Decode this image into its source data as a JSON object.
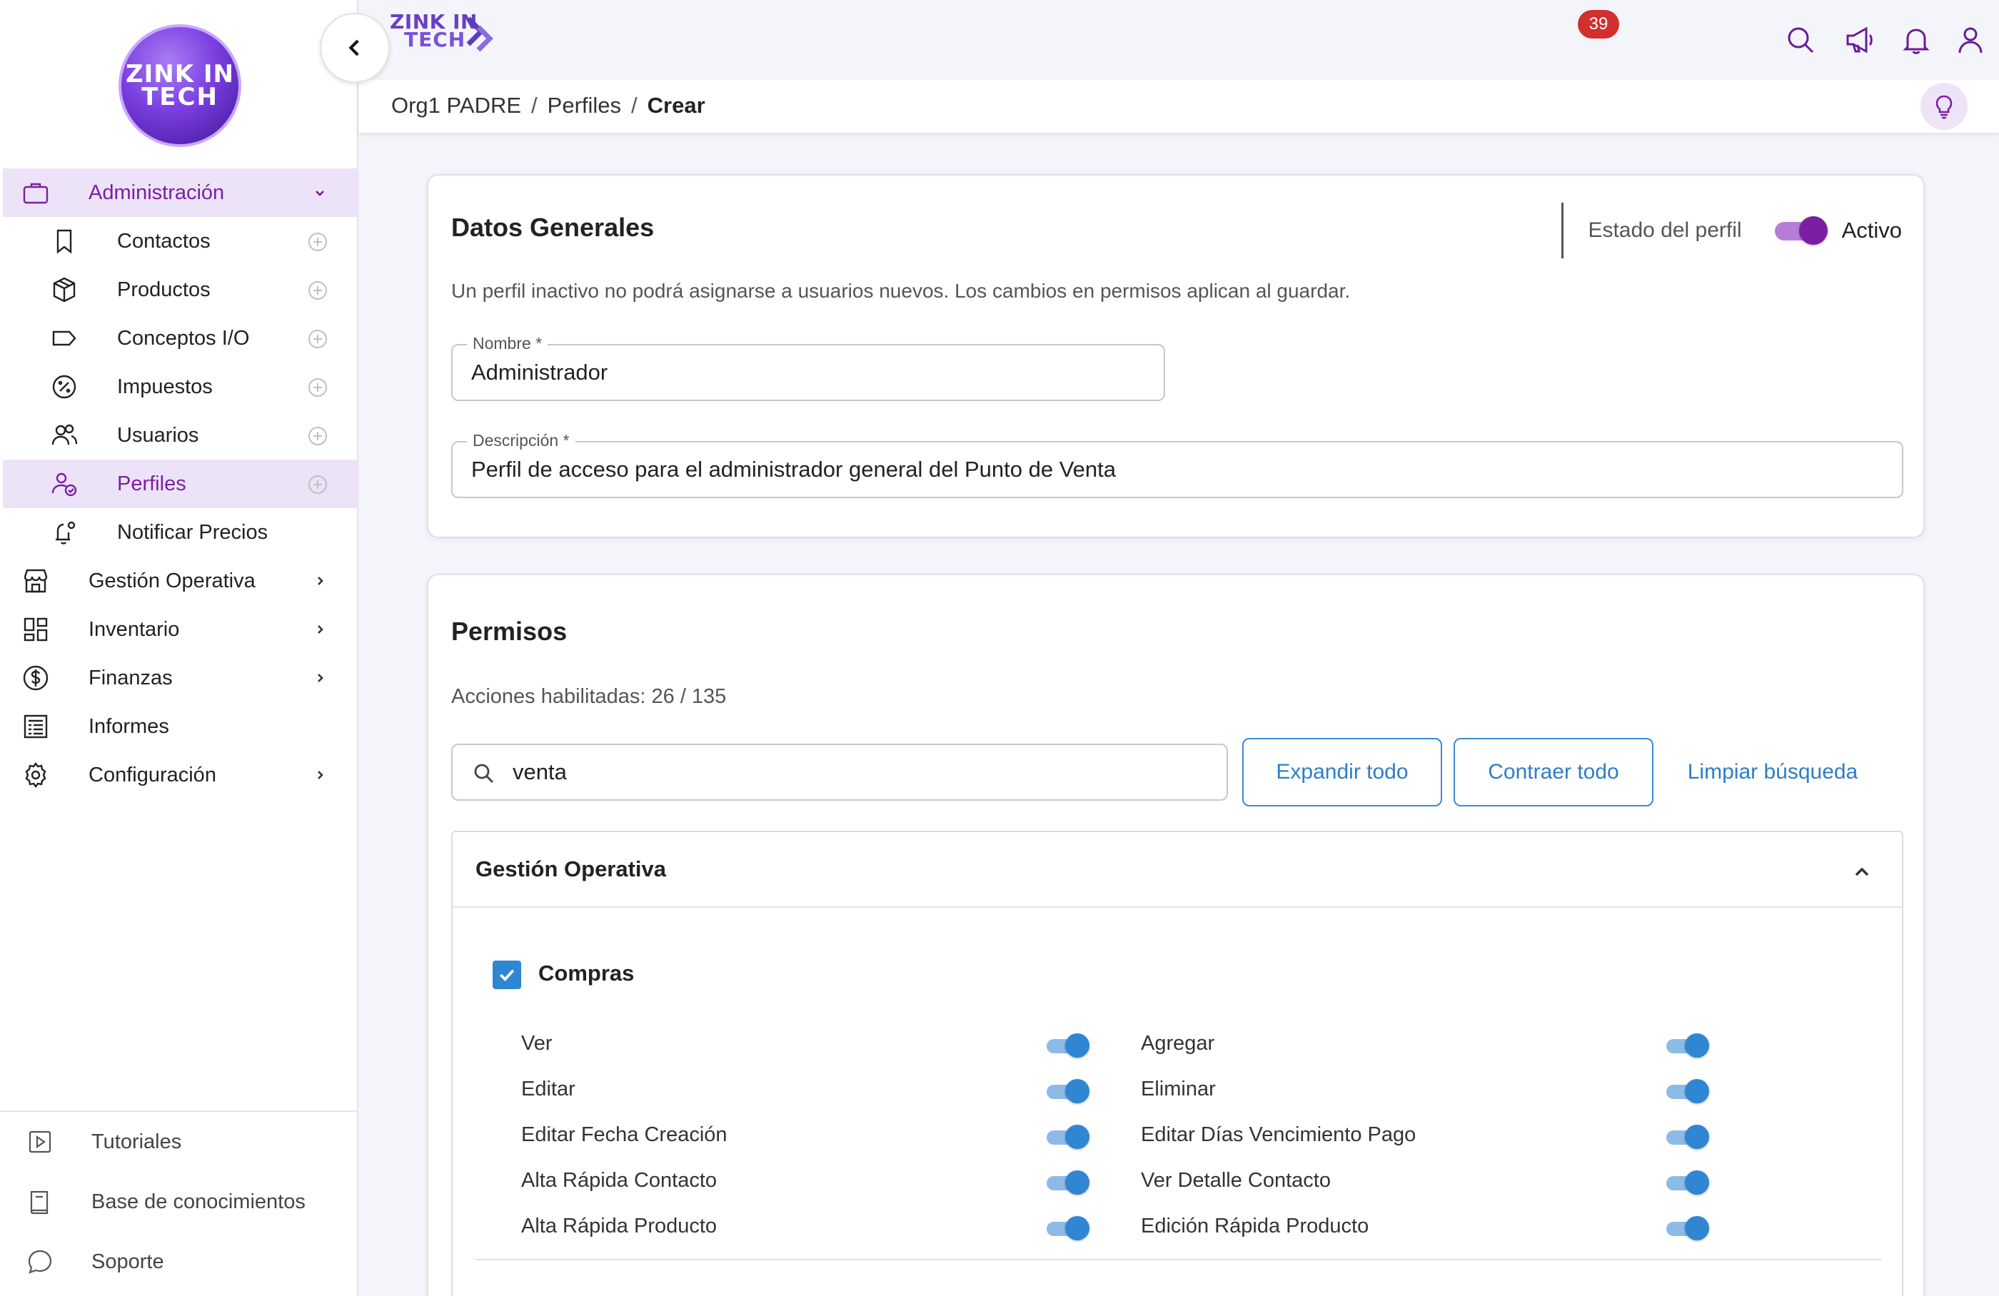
{
  "sidebar": {
    "logo": {
      "line1": "ZINK IN",
      "line2": "TECH"
    },
    "admin": {
      "label": "Administración"
    },
    "sub_items": [
      {
        "label": "Contactos",
        "icon": "bookmark-icon"
      },
      {
        "label": "Productos",
        "icon": "box-icon"
      },
      {
        "label": "Conceptos I/O",
        "icon": "tag-icon"
      },
      {
        "label": "Impuestos",
        "icon": "percent-icon"
      },
      {
        "label": "Usuarios",
        "icon": "users-icon"
      },
      {
        "label": "Perfiles",
        "icon": "profile-check-icon"
      },
      {
        "label": "Notificar Precios",
        "icon": "bell-gear-icon"
      }
    ],
    "sections": [
      {
        "label": "Gestión Operativa",
        "icon": "store-icon"
      },
      {
        "label": "Inventario",
        "icon": "grid-icon"
      },
      {
        "label": "Finanzas",
        "icon": "dollar-icon"
      },
      {
        "label": "Informes",
        "icon": "report-icon"
      },
      {
        "label": "Configuración",
        "icon": "gear-icon"
      }
    ],
    "bottom": [
      {
        "label": "Tutoriales",
        "icon": "play-icon"
      },
      {
        "label": "Base de conocimientos",
        "icon": "book-icon"
      },
      {
        "label": "Soporte",
        "icon": "chat-icon"
      }
    ]
  },
  "topbar": {
    "brand": {
      "line1": "ZINK IN",
      "line2": "TECH"
    },
    "notifications_count": "39"
  },
  "breadcrumb": {
    "items": [
      "Org1 PADRE",
      "Perfiles",
      "Crear"
    ],
    "separator": "/"
  },
  "general": {
    "title": "Datos Generales",
    "status_label": "Estado del perfil",
    "status_value": "Activo",
    "hint": "Un perfil inactivo no podrá asignarse a usuarios nuevos. Los cambios en permisos aplican al guardar.",
    "name": {
      "label": "Nombre *",
      "value": "Administrador"
    },
    "description": {
      "label": "Descripción *",
      "value": "Perfil de acceso para el administrador general del Punto de Venta"
    }
  },
  "permissions": {
    "title": "Permisos",
    "counter": "Acciones habilitadas: 26 / 135",
    "search_value": "venta",
    "expand_label": "Expandir todo",
    "contract_label": "Contraer todo",
    "clear_label": "Limpiar búsqueda",
    "section": {
      "title": "Gestión Operativa",
      "group": {
        "label": "Compras",
        "checked": true,
        "left": [
          {
            "label": "Ver",
            "enabled": true
          },
          {
            "label": "Editar",
            "enabled": true
          },
          {
            "label": "Editar Fecha Creación",
            "enabled": true
          },
          {
            "label": "Alta Rápida Contacto",
            "enabled": true
          },
          {
            "label": "Alta Rápida Producto",
            "enabled": true
          }
        ],
        "right": [
          {
            "label": "Agregar",
            "enabled": true
          },
          {
            "label": "Eliminar",
            "enabled": true
          },
          {
            "label": "Editar Días Vencimiento Pago",
            "enabled": true
          },
          {
            "label": "Ver Detalle Contacto",
            "enabled": true
          },
          {
            "label": "Edición Rápida Producto",
            "enabled": true
          }
        ]
      }
    }
  },
  "colors": {
    "accent_purple": "#7b1fa2",
    "active_bg": "#ede3f8",
    "primary_blue": "#2f86d3",
    "badge_red": "#d32f2f"
  }
}
